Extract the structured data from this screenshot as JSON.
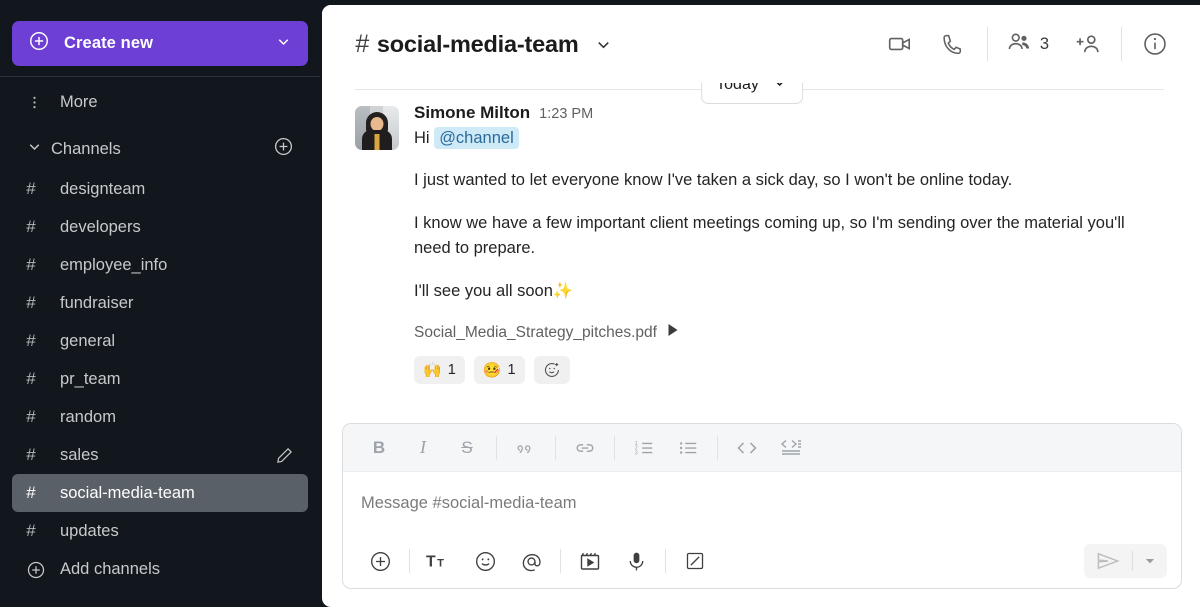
{
  "theme": {
    "sidebar_bg": "#11171c",
    "accent_purple": "#6d3fd4",
    "mention_bg": "#cfeaf7",
    "mention_text": "#2b6a9c",
    "selected_channel_bg": "#5a6067"
  },
  "sidebar": {
    "create_new": {
      "label": "Create new",
      "icon": "plus-circle-icon",
      "chevron": "chevron-down-icon"
    },
    "more": {
      "label": "More",
      "icon": "more-vertical-icon"
    },
    "channels_section": {
      "label": "Channels",
      "chevron": "chevron-down-icon",
      "add_icon": "plus-circle-icon"
    },
    "channels": [
      {
        "name": "designteam",
        "selected": false
      },
      {
        "name": "developers",
        "selected": false
      },
      {
        "name": "employee_info",
        "selected": false
      },
      {
        "name": "fundraiser",
        "selected": false
      },
      {
        "name": "general",
        "selected": false
      },
      {
        "name": "pr_team",
        "selected": false
      },
      {
        "name": "random",
        "selected": false
      },
      {
        "name": "sales",
        "selected": false,
        "pencil": "pencil-icon"
      },
      {
        "name": "social-media-team",
        "selected": true
      },
      {
        "name": "updates",
        "selected": false
      }
    ],
    "add_channels": {
      "label": "Add channels",
      "icon": "plus-circle-icon"
    }
  },
  "header": {
    "hash": "#",
    "channel_name": "social-media-team",
    "chevron": "chevron-down-icon",
    "actions": {
      "video": "video-camera-icon",
      "call": "phone-icon",
      "people_icon": "people-icon",
      "people_count": "3",
      "add_person": "add-person-icon",
      "info": "info-circle-icon"
    }
  },
  "conversation": {
    "day_divider": {
      "label": "Today",
      "chevron": "chevron-down-icon"
    },
    "message": {
      "author": "Simone Milton",
      "time": "1:23 PM",
      "avatar": "user-avatar",
      "greeting": "Hi",
      "mention": "@channel",
      "paragraphs": [
        "I just wanted to let everyone know I've taken a sick day, so I won't be online today.",
        "I know we have a few important client meetings coming up, so I'm sending over the material you'll need to prepare.",
        "I'll see you all soon"
      ],
      "closing_emoji": "✨",
      "attachment": {
        "name": "Social_Media_Strategy_pitches.pdf",
        "expand_icon": "triangle-right-icon"
      },
      "reactions": [
        {
          "emoji": "🙌",
          "name": "raised-hands",
          "count": "1"
        },
        {
          "emoji": "🤒",
          "name": "face-with-thermometer",
          "count": "1"
        }
      ],
      "add_reaction": {
        "icon": "add-reaction-icon"
      }
    }
  },
  "composer": {
    "placeholder": "Message #social-media-team",
    "format_tools": [
      {
        "name": "bold",
        "label": "B"
      },
      {
        "name": "italic",
        "label": "I"
      },
      {
        "name": "strikethrough",
        "label": "S"
      },
      {
        "name": "quote",
        "label": "””"
      },
      {
        "name": "link",
        "label": ""
      },
      {
        "name": "ordered-list",
        "label": ""
      },
      {
        "name": "bulleted-list",
        "label": ""
      },
      {
        "name": "code",
        "label": "<>"
      },
      {
        "name": "code-block",
        "label": ""
      }
    ],
    "bottom_tools": [
      {
        "name": "attach-plus",
        "label": ""
      },
      {
        "name": "format-text",
        "label": "T"
      },
      {
        "name": "emoji",
        "label": ""
      },
      {
        "name": "mention",
        "label": "@"
      },
      {
        "name": "giphy",
        "label": ""
      },
      {
        "name": "voice-message",
        "label": ""
      },
      {
        "name": "loop-component",
        "label": ""
      }
    ],
    "send": {
      "icon": "send-icon",
      "chevron": "chevron-down-icon"
    }
  }
}
